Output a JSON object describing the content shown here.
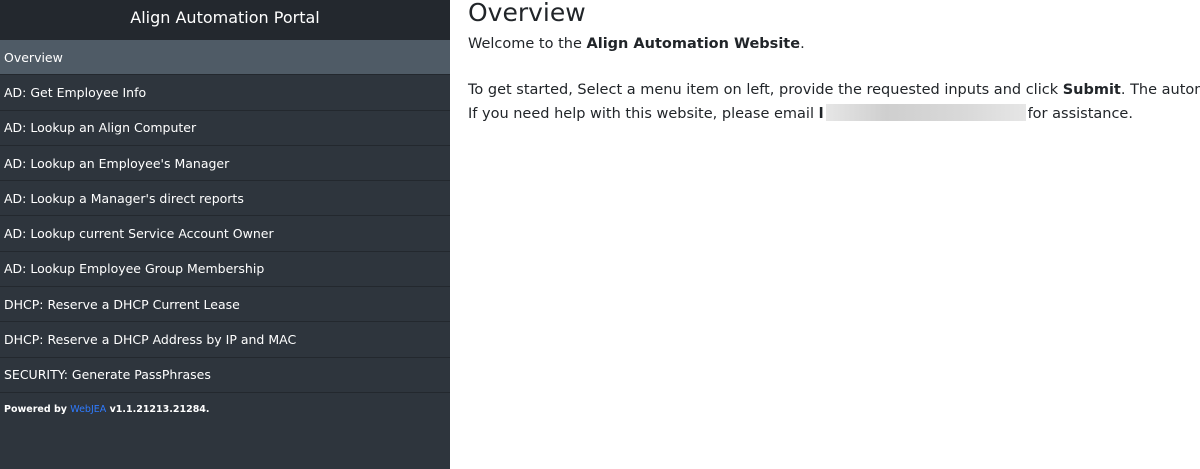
{
  "sidebar": {
    "title": "Align Automation Portal",
    "items": [
      {
        "label": "Overview",
        "active": true
      },
      {
        "label": "AD: Get Employee Info"
      },
      {
        "label": "AD: Lookup an Align Computer"
      },
      {
        "label": "AD: Lookup an Employee's Manager"
      },
      {
        "label": "AD: Lookup a Manager's direct reports"
      },
      {
        "label": "AD: Lookup current Service Account Owner"
      },
      {
        "label": "AD: Lookup Employee Group Membership"
      },
      {
        "label": "DHCP: Reserve a DHCP Current Lease"
      },
      {
        "label": "DHCP: Reserve a DHCP Address by IP and MAC"
      },
      {
        "label": "SECURITY: Generate PassPhrases"
      }
    ],
    "footer": {
      "prefix": "Powered by",
      "link": "WebJEA",
      "version": "v1.1.21213.21284."
    }
  },
  "main": {
    "title": "Overview",
    "welcome_prefix": "Welcome to the",
    "welcome_bold": "Align Automation Website",
    "welcome_suffix": ".",
    "line1_prefix": "To get started, Select a menu item on left, provide the requested inputs and click",
    "line1_bold": "Submit",
    "line1_suffix": ". The automation",
    "line2_prefix": "If you need help with this website, please email",
    "line2_email_start": "l",
    "line2_suffix": "for assistance."
  },
  "colors": {
    "sidebar_bg": "#2e353d",
    "sidebar_header_bg": "#23282e",
    "active_item_bg": "#4f5b66",
    "link": "#2f7bff"
  }
}
